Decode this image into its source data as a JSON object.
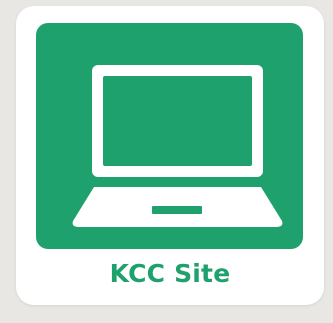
{
  "tile": {
    "label": "KCC Site",
    "icon": "laptop-icon",
    "accent_color": "#1ea16c",
    "background_color": "#ffffff"
  }
}
